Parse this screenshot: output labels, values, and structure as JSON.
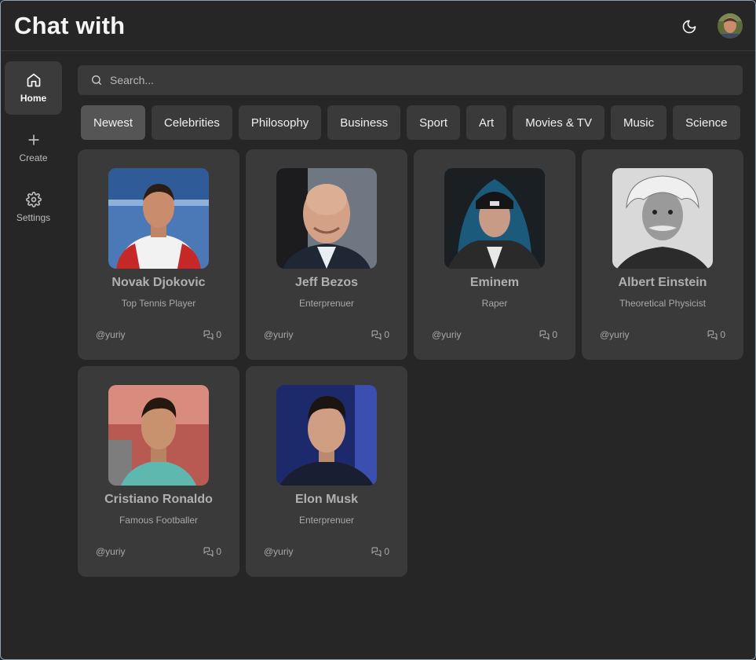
{
  "header": {
    "title": "Chat with",
    "theme_icon": "moon-icon",
    "avatar_icon": "user-avatar"
  },
  "sidebar": {
    "items": [
      {
        "label": "Home",
        "icon": "home-icon",
        "active": true
      },
      {
        "label": "Create",
        "icon": "plus-icon",
        "active": false
      },
      {
        "label": "Settings",
        "icon": "gear-icon",
        "active": false
      }
    ]
  },
  "search": {
    "placeholder": "Search...",
    "value": ""
  },
  "categories": [
    "Newest",
    "Celebrities",
    "Philosophy",
    "Business",
    "Sport",
    "Art",
    "Movies & TV",
    "Music",
    "Science"
  ],
  "active_category": "Newest",
  "companions": [
    {
      "name": "Novak Djokovic",
      "description": "Top Tennis Player",
      "author": "@yuriy",
      "messages": "0"
    },
    {
      "name": "Jeff Bezos",
      "description": "Enterprenuer",
      "author": "@yuriy",
      "messages": "0"
    },
    {
      "name": "Eminem",
      "description": "Raper",
      "author": "@yuriy",
      "messages": "0"
    },
    {
      "name": "Albert Einstein",
      "description": "Theoretical Physicist",
      "author": "@yuriy",
      "messages": "0"
    },
    {
      "name": "Cristiano Ronaldo",
      "description": "Famous Footballer",
      "author": "@yuriy",
      "messages": "0"
    },
    {
      "name": "Elon Musk",
      "description": "Enterprenuer",
      "author": "@yuriy",
      "messages": "0"
    }
  ],
  "colors": {
    "background": "#262626",
    "surface": "#3a3a3a",
    "active": "#555555",
    "text": "#f5f5f5",
    "muted": "#a8a8a8"
  }
}
